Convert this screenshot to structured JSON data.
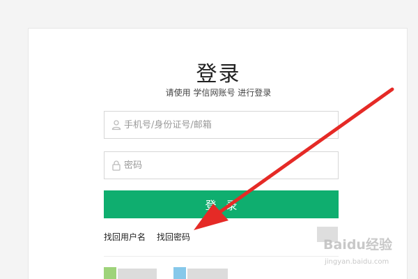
{
  "login": {
    "title": "登录",
    "subtitle": "请使用 学信网账号 进行登录",
    "username": {
      "placeholder": "手机号/身份证号/邮箱",
      "value": ""
    },
    "password": {
      "placeholder": "密码",
      "value": ""
    },
    "submit_label": "登录",
    "links": {
      "find_username": "找回用户名",
      "find_password": "找回密码"
    }
  },
  "watermark": {
    "brand": "Baidu经验",
    "url": "jingyan.baidu.com"
  },
  "colors": {
    "primary_button": "#0fae6f",
    "annotation_arrow": "#e52a26"
  },
  "icons": {
    "username_field": "user-icon",
    "password_field": "lock-icon",
    "annotation": "red-arrow"
  }
}
